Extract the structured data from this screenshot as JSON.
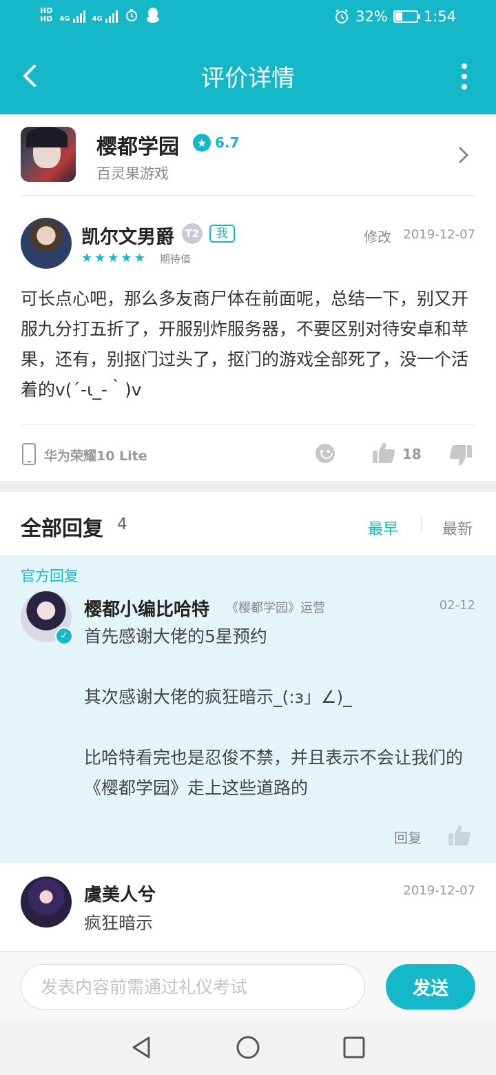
{
  "status": {
    "time": "1:54",
    "battery": "32%",
    "battery_level": 0.32,
    "net1": "4G",
    "net2": "4G",
    "hd_label": "HD"
  },
  "header": {
    "title": "评价详情"
  },
  "game": {
    "name": "樱都学园",
    "score": "6.7",
    "developer": "百灵果游戏"
  },
  "review": {
    "author": "凯尔文男爵",
    "level_badge": "T2",
    "me_tag": "我",
    "edit": "修改",
    "date": "2019-12-07",
    "rating": 5,
    "rating_label": "期待值",
    "text": "可长点心吧，那么多友商尸体在前面呢，总结一下，别又开服九分打五折了，开服别炸服务器，不要区别对待安卓和苹果，还有，别抠门过头了，抠门的游戏全部死了，没一个活着的v(´-ι_-｀)v",
    "device": "华为荣耀10 Lite",
    "likes": "18"
  },
  "replies": {
    "title": "全部回复",
    "count": "4",
    "sort_earliest": "最早",
    "sort_newest": "最新"
  },
  "official_reply": {
    "label": "官方回复",
    "author": "樱都小编比哈特",
    "role": "《樱都学园》运营",
    "date": "02-12",
    "text": "首先感谢大佬的5星预约\n\n其次感谢大佬的疯狂暗示_(:з」∠)_\n\n比哈特看完也是忍俊不禁，并且表示不会让我们的《樱都学园》走上这些道路的",
    "reply_label": "回复"
  },
  "reply2": {
    "author": "虞美人兮",
    "date": "2019-12-07",
    "text": "疯狂暗示"
  },
  "composer": {
    "placeholder": "发表内容前需通过礼仪考试",
    "send_label": "发送"
  },
  "colors": {
    "accent": "#15b8c9",
    "official_bg": "#e3f5f9"
  }
}
